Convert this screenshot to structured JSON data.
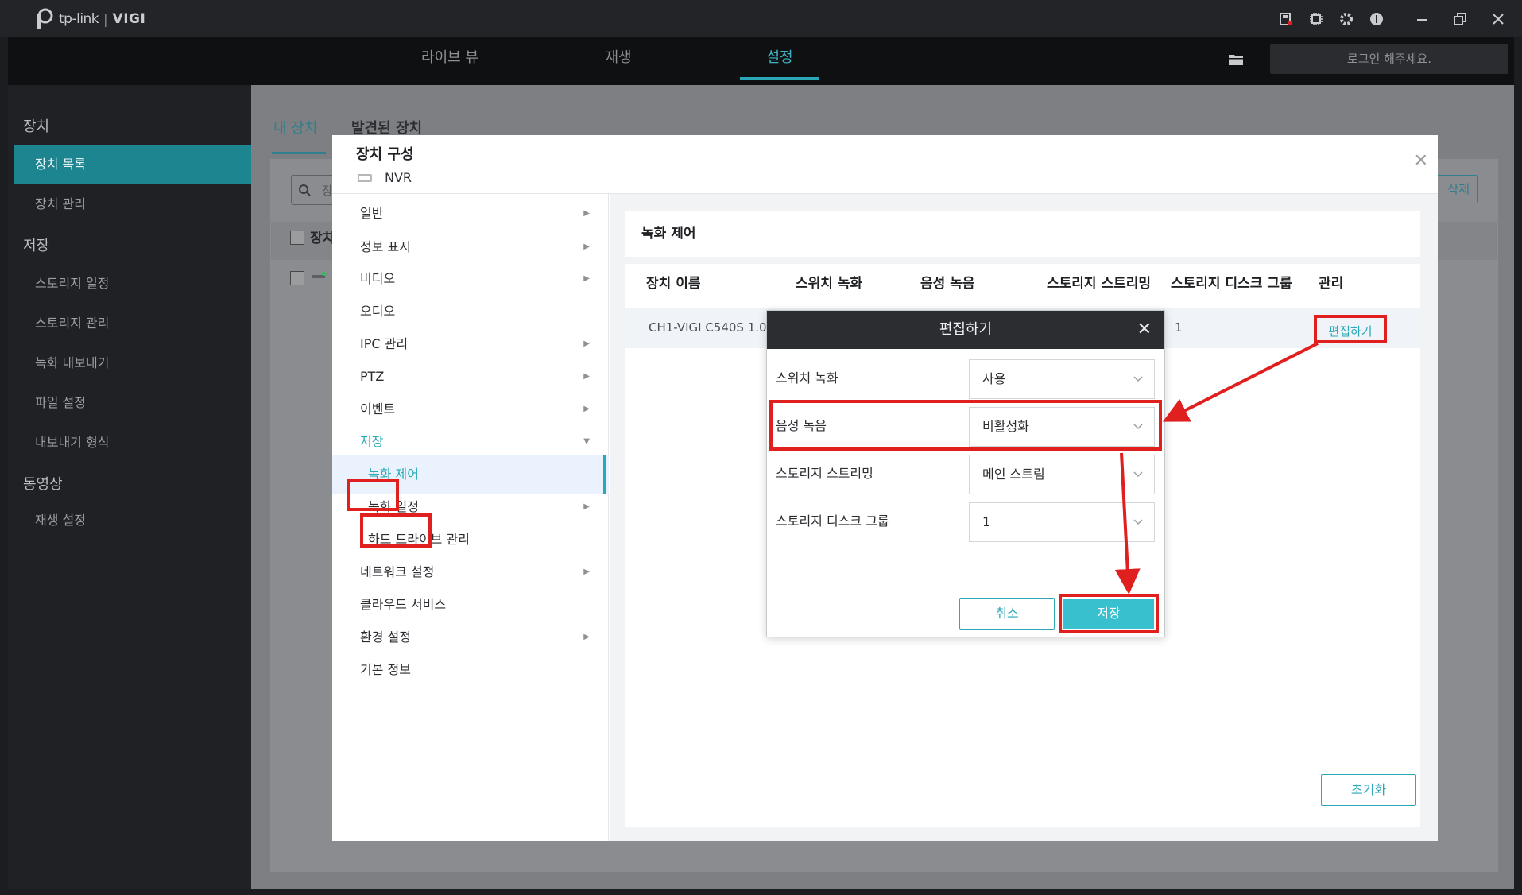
{
  "app": {
    "brand": "tp-link",
    "product": "VIGI"
  },
  "titlebar_icons": [
    "storage-alert-icon",
    "cpu-icon",
    "gear-icon",
    "info-icon"
  ],
  "window_controls": [
    "minimize-icon",
    "restore-icon",
    "close-icon"
  ],
  "topnav": {
    "tabs": [
      {
        "label": "라이브 뷰",
        "active": false
      },
      {
        "label": "재생",
        "active": false
      },
      {
        "label": "설정",
        "active": true
      }
    ],
    "login_label": "로그인 해주세요."
  },
  "sidebar": {
    "sections": [
      {
        "title": "장치",
        "items": [
          {
            "label": "장치 목록",
            "active": true
          },
          {
            "label": "장치 관리"
          }
        ]
      },
      {
        "title": "저장",
        "items": [
          {
            "label": "스토리지 일정"
          },
          {
            "label": "스토리지 관리"
          },
          {
            "label": "녹화 내보내기"
          },
          {
            "label": "파일 설정"
          },
          {
            "label": "내보내기 형식"
          }
        ]
      },
      {
        "title": "동영상",
        "items": [
          {
            "label": "재생 설정"
          }
        ]
      }
    ]
  },
  "main": {
    "tabs": [
      {
        "label": "내 장치",
        "active": true
      },
      {
        "label": "발견된 장치"
      }
    ],
    "delete_label": "삭제",
    "name_col_fragment": "장치",
    "search_fragment": "장"
  },
  "modal": {
    "title": "장치 구성",
    "device": "NVR",
    "menu": [
      {
        "label": "일반",
        "arrow": "right"
      },
      {
        "label": "정보 표시",
        "arrow": "right"
      },
      {
        "label": "비디오",
        "arrow": "right"
      },
      {
        "label": "오디오"
      },
      {
        "label": "IPC 관리",
        "arrow": "right"
      },
      {
        "label": "PTZ",
        "arrow": "right"
      },
      {
        "label": "이벤트",
        "arrow": "right"
      },
      {
        "label": "저장",
        "arrow": "down"
      },
      {
        "label": "녹화 제어",
        "sub": true,
        "selected": true
      },
      {
        "label": "녹화 일정",
        "sub": true,
        "arrow": "right"
      },
      {
        "label": "하드 드라이브 관리",
        "sub": true
      },
      {
        "label": "네트워크 설정",
        "arrow": "right"
      },
      {
        "label": "클라우드 서비스"
      },
      {
        "label": "환경 설정",
        "arrow": "right"
      },
      {
        "label": "기본 정보"
      }
    ],
    "panel": {
      "title": "녹화 제어",
      "columns": [
        "장치 이름",
        "스위치 녹화",
        "음성 녹음",
        "스토리지 스트리밍",
        "스토리지 디스크 그룹",
        "관리"
      ],
      "row": {
        "name": "CH1-VIGI C540S 1.0",
        "disk_group": "1",
        "action": "편집하기"
      },
      "reset_label": "초기화"
    }
  },
  "edit_dialog": {
    "title": "편집하기",
    "fields": [
      {
        "label": "스위치 녹화",
        "value": "사용"
      },
      {
        "label": "음성 녹음",
        "value": "비활성화"
      },
      {
        "label": "스토리지 스트리밍",
        "value": "메인 스트림"
      },
      {
        "label": "스토리지 디스크 그룹",
        "value": "1"
      }
    ],
    "cancel_label": "취소",
    "save_label": "저장"
  },
  "colors": {
    "accent": "#2aa8b8",
    "highlight": "#e0201e",
    "save": "#39c0ce"
  }
}
